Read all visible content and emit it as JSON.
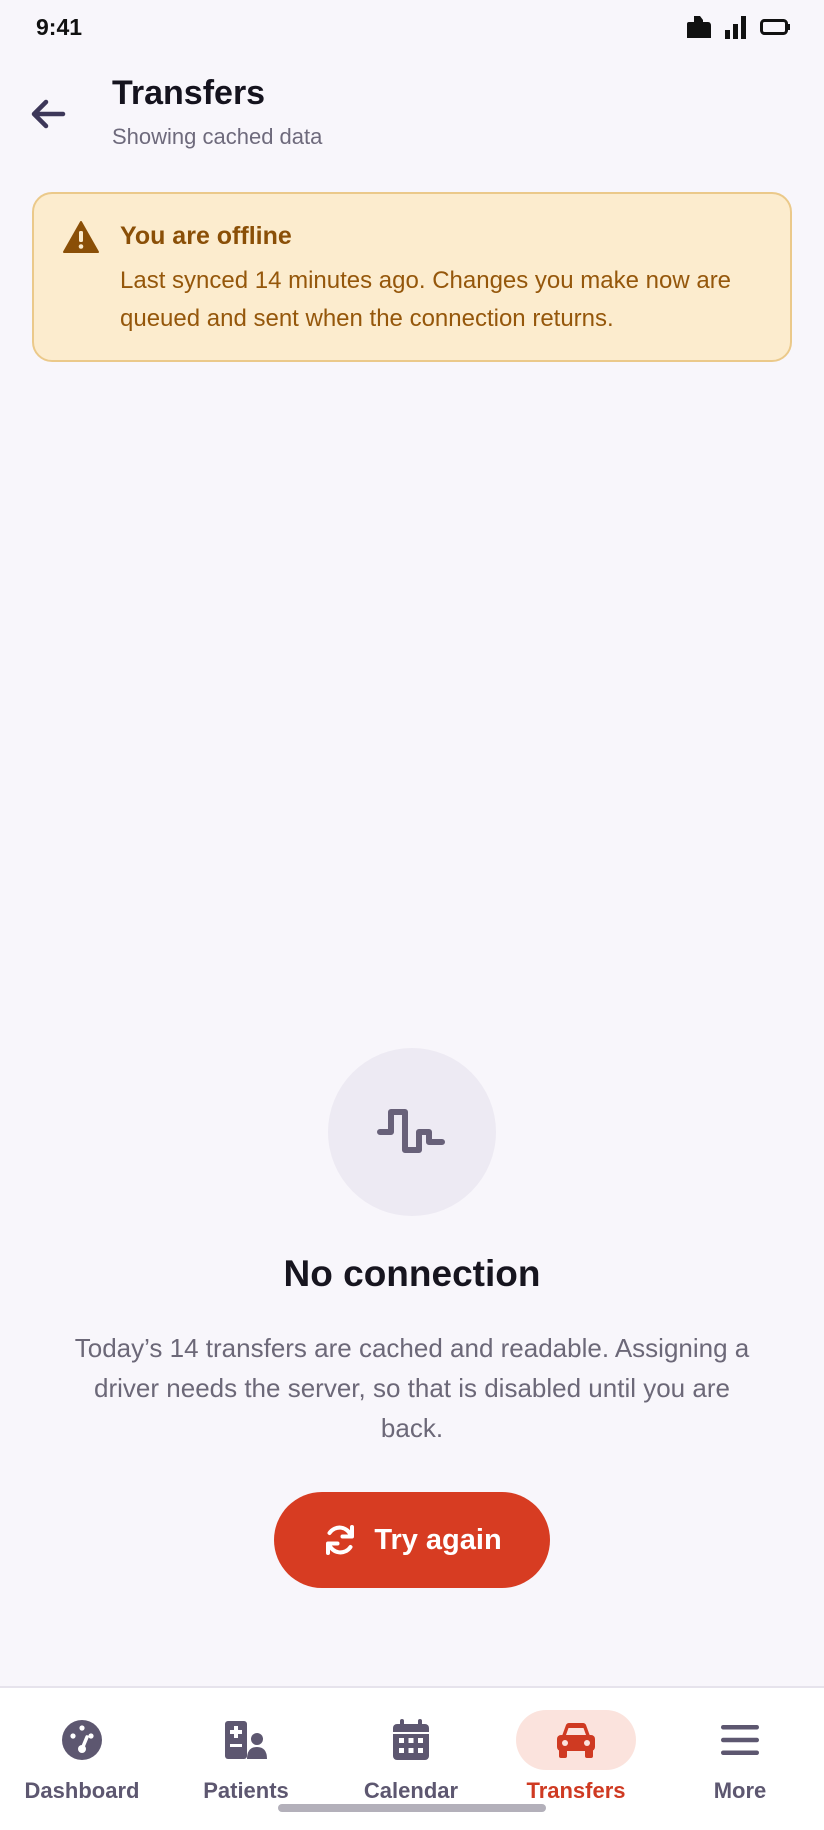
{
  "status_bar": {
    "time": "9:41",
    "icons": [
      "notification-icon",
      "cellular-signal-icon",
      "battery-icon"
    ]
  },
  "app_bar": {
    "title": "Transfers",
    "subtitle": "Showing cached data",
    "back_icon": "arrow-left-icon"
  },
  "banner": {
    "title": "You are offline",
    "body": "Last synced 14 minutes ago. Changes you make now are queued and sent when the connection returns.",
    "icon": "warning-triangle-icon"
  },
  "empty_state": {
    "icon": "disconnected-signal-icon",
    "title": "No connection",
    "body": "Today’s 14 transfers are cached and readable. Assigning a driver needs the server, so that is disabled until you are back.",
    "retry_label": "Try again"
  },
  "bottom_nav": {
    "items": [
      {
        "label": "Dashboard",
        "icon": "dashboard-gauge-icon",
        "active": false
      },
      {
        "label": "Patients",
        "icon": "patients-icon",
        "active": false
      },
      {
        "label": "Calendar",
        "icon": "calendar-icon",
        "active": false
      },
      {
        "label": "Transfers",
        "icon": "car-icon",
        "active": true
      },
      {
        "label": "More",
        "icon": "menu-icon",
        "active": false
      }
    ]
  },
  "colors": {
    "accent": "#d73c22",
    "banner_bg": "#fcecce",
    "banner_text": "#8a4f07",
    "background": "#f8f6fb"
  }
}
